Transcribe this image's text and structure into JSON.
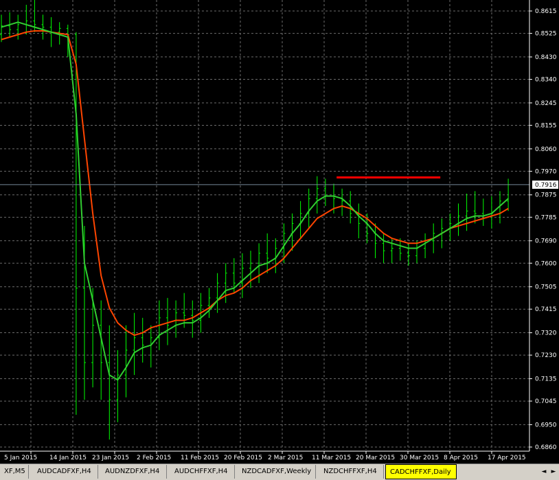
{
  "chart_data": {
    "type": "line",
    "symbol_tab_active": "CADCHFFXF,Daily",
    "y_ticks": [
      "0.8615",
      "0.8525",
      "0.8430",
      "0.8340",
      "0.8245",
      "0.8155",
      "0.8060",
      "0.7970",
      "0.7875",
      "0.7785",
      "0.7690",
      "0.7600",
      "0.7505",
      "0.7415",
      "0.7320",
      "0.7230",
      "0.7135",
      "0.7045",
      "0.6950",
      "0.6860"
    ],
    "ylim": [
      0.686,
      0.8615
    ],
    "x_ticks": [
      "5 Jan 2015",
      "14 Jan 2015",
      "23 Jan 2015",
      "2 Feb 2015",
      "11 Feb 2015",
      "20 Feb 2015",
      "2 Mar 2015",
      "11 Mar 2015",
      "20 Mar 2015",
      "30 Mar 2015",
      "8 Apr 2015",
      "17 Apr 2015"
    ],
    "current_price": "0.7916",
    "current_price_value": 0.7916,
    "resistance_line": {
      "value": 0.7945,
      "start_bar": 42,
      "end_bar": 52
    },
    "bars": [
      [
        0.852,
        0.86,
        0.849,
        0.8555
      ],
      [
        0.8555,
        0.861,
        0.851,
        0.854
      ],
      [
        0.854,
        0.86,
        0.85,
        0.856
      ],
      [
        0.856,
        0.864,
        0.852,
        0.8575
      ],
      [
        0.8575,
        0.866,
        0.853,
        0.856
      ],
      [
        0.856,
        0.86,
        0.85,
        0.855
      ],
      [
        0.855,
        0.859,
        0.847,
        0.853
      ],
      [
        0.853,
        0.857,
        0.848,
        0.8545
      ],
      [
        0.8545,
        0.856,
        0.843,
        0.852
      ],
      [
        0.852,
        0.853,
        0.699,
        0.75
      ],
      [
        0.75,
        0.775,
        0.705,
        0.72
      ],
      [
        0.72,
        0.75,
        0.71,
        0.735
      ],
      [
        0.735,
        0.745,
        0.705,
        0.72
      ],
      [
        0.72,
        0.735,
        0.689,
        0.705
      ],
      [
        0.705,
        0.725,
        0.696,
        0.715
      ],
      [
        0.715,
        0.735,
        0.706,
        0.725
      ],
      [
        0.725,
        0.74,
        0.715,
        0.73
      ],
      [
        0.73,
        0.738,
        0.72,
        0.727
      ],
      [
        0.727,
        0.735,
        0.718,
        0.73
      ],
      [
        0.73,
        0.745,
        0.725,
        0.738
      ],
      [
        0.738,
        0.746,
        0.727,
        0.735
      ],
      [
        0.735,
        0.745,
        0.73,
        0.74
      ],
      [
        0.74,
        0.748,
        0.734,
        0.739
      ],
      [
        0.739,
        0.745,
        0.73,
        0.737
      ],
      [
        0.737,
        0.748,
        0.732,
        0.743
      ],
      [
        0.743,
        0.75,
        0.738,
        0.746
      ],
      [
        0.746,
        0.756,
        0.74,
        0.752
      ],
      [
        0.752,
        0.76,
        0.744,
        0.756
      ],
      [
        0.756,
        0.762,
        0.748,
        0.752
      ],
      [
        0.752,
        0.764,
        0.746,
        0.758
      ],
      [
        0.758,
        0.765,
        0.75,
        0.76
      ],
      [
        0.76,
        0.768,
        0.752,
        0.764
      ],
      [
        0.764,
        0.772,
        0.756,
        0.762
      ],
      [
        0.762,
        0.77,
        0.756,
        0.766
      ],
      [
        0.766,
        0.776,
        0.76,
        0.772
      ],
      [
        0.772,
        0.78,
        0.765,
        0.776
      ],
      [
        0.776,
        0.785,
        0.77,
        0.78
      ],
      [
        0.78,
        0.79,
        0.774,
        0.786
      ],
      [
        0.786,
        0.795,
        0.78,
        0.79
      ],
      [
        0.79,
        0.794,
        0.783,
        0.787
      ],
      [
        0.787,
        0.792,
        0.78,
        0.786
      ],
      [
        0.786,
        0.79,
        0.779,
        0.785
      ],
      [
        0.785,
        0.789,
        0.776,
        0.78
      ],
      [
        0.78,
        0.784,
        0.77,
        0.776
      ],
      [
        0.776,
        0.78,
        0.768,
        0.772
      ],
      [
        0.772,
        0.776,
        0.762,
        0.768
      ],
      [
        0.768,
        0.772,
        0.76,
        0.765
      ],
      [
        0.765,
        0.77,
        0.76,
        0.766
      ],
      [
        0.766,
        0.77,
        0.761,
        0.764
      ],
      [
        0.764,
        0.768,
        0.759,
        0.763
      ],
      [
        0.763,
        0.769,
        0.76,
        0.766
      ],
      [
        0.766,
        0.772,
        0.762,
        0.769
      ],
      [
        0.769,
        0.776,
        0.764,
        0.772
      ],
      [
        0.772,
        0.778,
        0.766,
        0.774
      ],
      [
        0.774,
        0.78,
        0.769,
        0.776
      ],
      [
        0.776,
        0.784,
        0.771,
        0.779
      ],
      [
        0.779,
        0.788,
        0.773,
        0.781
      ],
      [
        0.781,
        0.789,
        0.776,
        0.78
      ],
      [
        0.78,
        0.786,
        0.775,
        0.779
      ],
      [
        0.779,
        0.787,
        0.774,
        0.78
      ],
      [
        0.78,
        0.789,
        0.776,
        0.785
      ],
      [
        0.785,
        0.794,
        0.781,
        0.7916
      ]
    ],
    "fast_ma": [
      0.855,
      0.856,
      0.857,
      0.856,
      0.855,
      0.854,
      0.853,
      0.852,
      0.851,
      0.82,
      0.76,
      0.745,
      0.73,
      0.715,
      0.713,
      0.718,
      0.724,
      0.726,
      0.727,
      0.731,
      0.733,
      0.735,
      0.736,
      0.736,
      0.738,
      0.741,
      0.745,
      0.749,
      0.75,
      0.753,
      0.756,
      0.759,
      0.76,
      0.762,
      0.767,
      0.772,
      0.776,
      0.781,
      0.785,
      0.787,
      0.787,
      0.786,
      0.783,
      0.779,
      0.776,
      0.772,
      0.769,
      0.768,
      0.767,
      0.766,
      0.766,
      0.768,
      0.77,
      0.772,
      0.774,
      0.776,
      0.778,
      0.779,
      0.779,
      0.78,
      0.783,
      0.786
    ],
    "slow_ma": [
      0.85,
      0.851,
      0.852,
      0.853,
      0.8535,
      0.8535,
      0.853,
      0.8525,
      0.852,
      0.84,
      0.81,
      0.78,
      0.755,
      0.742,
      0.736,
      0.733,
      0.731,
      0.732,
      0.734,
      0.735,
      0.736,
      0.737,
      0.737,
      0.738,
      0.74,
      0.742,
      0.745,
      0.747,
      0.748,
      0.75,
      0.753,
      0.755,
      0.757,
      0.759,
      0.762,
      0.766,
      0.77,
      0.774,
      0.778,
      0.78,
      0.782,
      0.783,
      0.782,
      0.78,
      0.778,
      0.775,
      0.772,
      0.77,
      0.769,
      0.768,
      0.768,
      0.769,
      0.77,
      0.772,
      0.774,
      0.775,
      0.776,
      0.777,
      0.778,
      0.779,
      0.78,
      0.782
    ],
    "colors": {
      "background": "#000000",
      "grid": "#6c6c6c",
      "bars": "#00ff00",
      "fast_ma": "#32cd32",
      "slow_ma": "#ff4500",
      "resistance": "#ff0000",
      "price_line": "#778899"
    }
  },
  "tabs": [
    {
      "label": "XF,M5"
    },
    {
      "label": "AUDCADFXF,H4"
    },
    {
      "label": "AUDNZDFXF,H4"
    },
    {
      "label": "AUDCHFFXF,H4"
    },
    {
      "label": "NZDCADFXF,Weekly"
    },
    {
      "label": "NZDCHFFXF,H4"
    },
    {
      "label": "CADCHFFXF,Daily"
    }
  ],
  "nav": {
    "left": "◄",
    "right": "►"
  }
}
